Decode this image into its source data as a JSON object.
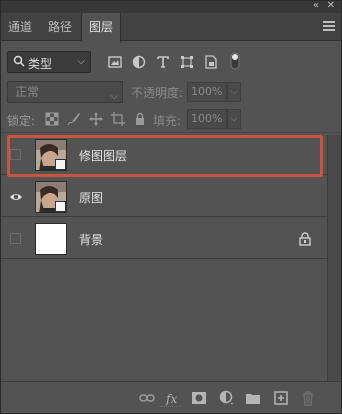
{
  "window": {
    "collapse_glyph": "«",
    "close_glyph": "✕"
  },
  "tabs": [
    {
      "label": "通道"
    },
    {
      "label": "路径"
    },
    {
      "label": "图层"
    }
  ],
  "filter": {
    "selected": "类型"
  },
  "blend_mode": {
    "value": "正常"
  },
  "opacity": {
    "label": "不透明度:",
    "value": "100%"
  },
  "lock": {
    "label": "锁定:"
  },
  "fill": {
    "label": "填充:",
    "value": "100%"
  },
  "layers": [
    {
      "name": "修图图层",
      "visible": false,
      "highlighted": true,
      "smart_object": true
    },
    {
      "name": "原图",
      "visible": true,
      "highlighted": false,
      "smart_object": true
    },
    {
      "name": "背景",
      "visible": false,
      "highlighted": false,
      "locked": true
    }
  ],
  "colors": {
    "highlight": "#c8553d",
    "panel_bg": "#535353",
    "tabbar_bg": "#424242"
  },
  "bottom_icons": [
    "link-icon",
    "fx-icon",
    "mask-icon",
    "adjustment-icon",
    "folder-icon",
    "new-layer-icon",
    "trash-icon"
  ]
}
